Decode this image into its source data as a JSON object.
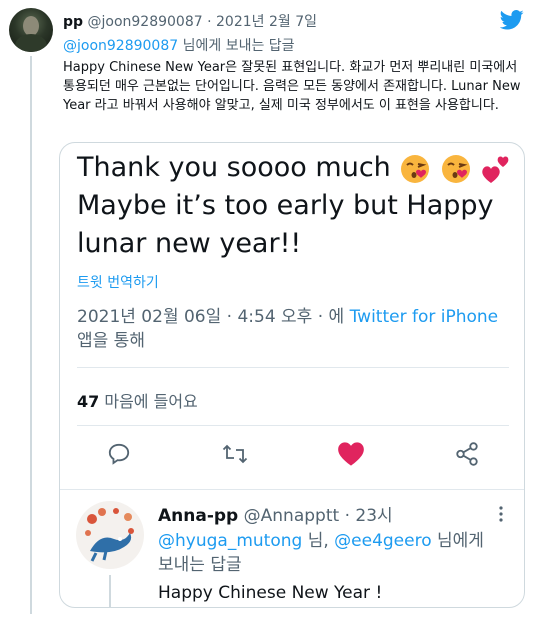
{
  "tweet": {
    "author_name": "pp",
    "author_handle": "@joon92890087",
    "separator": "·",
    "date": "2021년 2월 7일",
    "reply_to_handle": "@joon92890087",
    "reply_to_suffix": "님에게 보내는 답글",
    "text": "Happy Chinese New Year은 잘못된 표현입니다. 화교가 먼저 뿌리내린 미국에서 통용되던 매우 근본없는 단어입니다. 음력은 모든 동양에서 존재합니다. Lunar New Year 라고 바꿔서 사용해야 알맞고, 실제 미국 정부에서도 이 표현을 사용합니다."
  },
  "embed": {
    "line1": "Thank you soooo much",
    "line2": "Maybe it’s too early but Happy",
    "line3": "lunar new year!!",
    "translate_label": "트윗 번역하기",
    "meta_text": "2021년 02월 06일 · 4:54 오후 · 에 ",
    "meta_app": "Twitter for iPhone",
    "meta_suffix": "앱을 통해",
    "likes_count": "47",
    "likes_label": " 마음에 들어요",
    "icons": [
      "reply-icon",
      "retweet-icon",
      "like-icon",
      "share-icon"
    ],
    "like_color": "#e0245e"
  },
  "reply": {
    "author_name": "Anna-pp",
    "author_handle": "@Annapptt",
    "separator": "·",
    "time": "23시",
    "mention1": "@hyuga_mutong",
    "mention_joiner": " 님, ",
    "mention2": "@ee4geero",
    "reply_suffix": " 님에게 보내는 답글",
    "text": "Happy Chinese New Year !"
  },
  "colors": {
    "accent": "#1d9bf0",
    "secondary_text": "#536471",
    "border": "#cfd9de"
  }
}
